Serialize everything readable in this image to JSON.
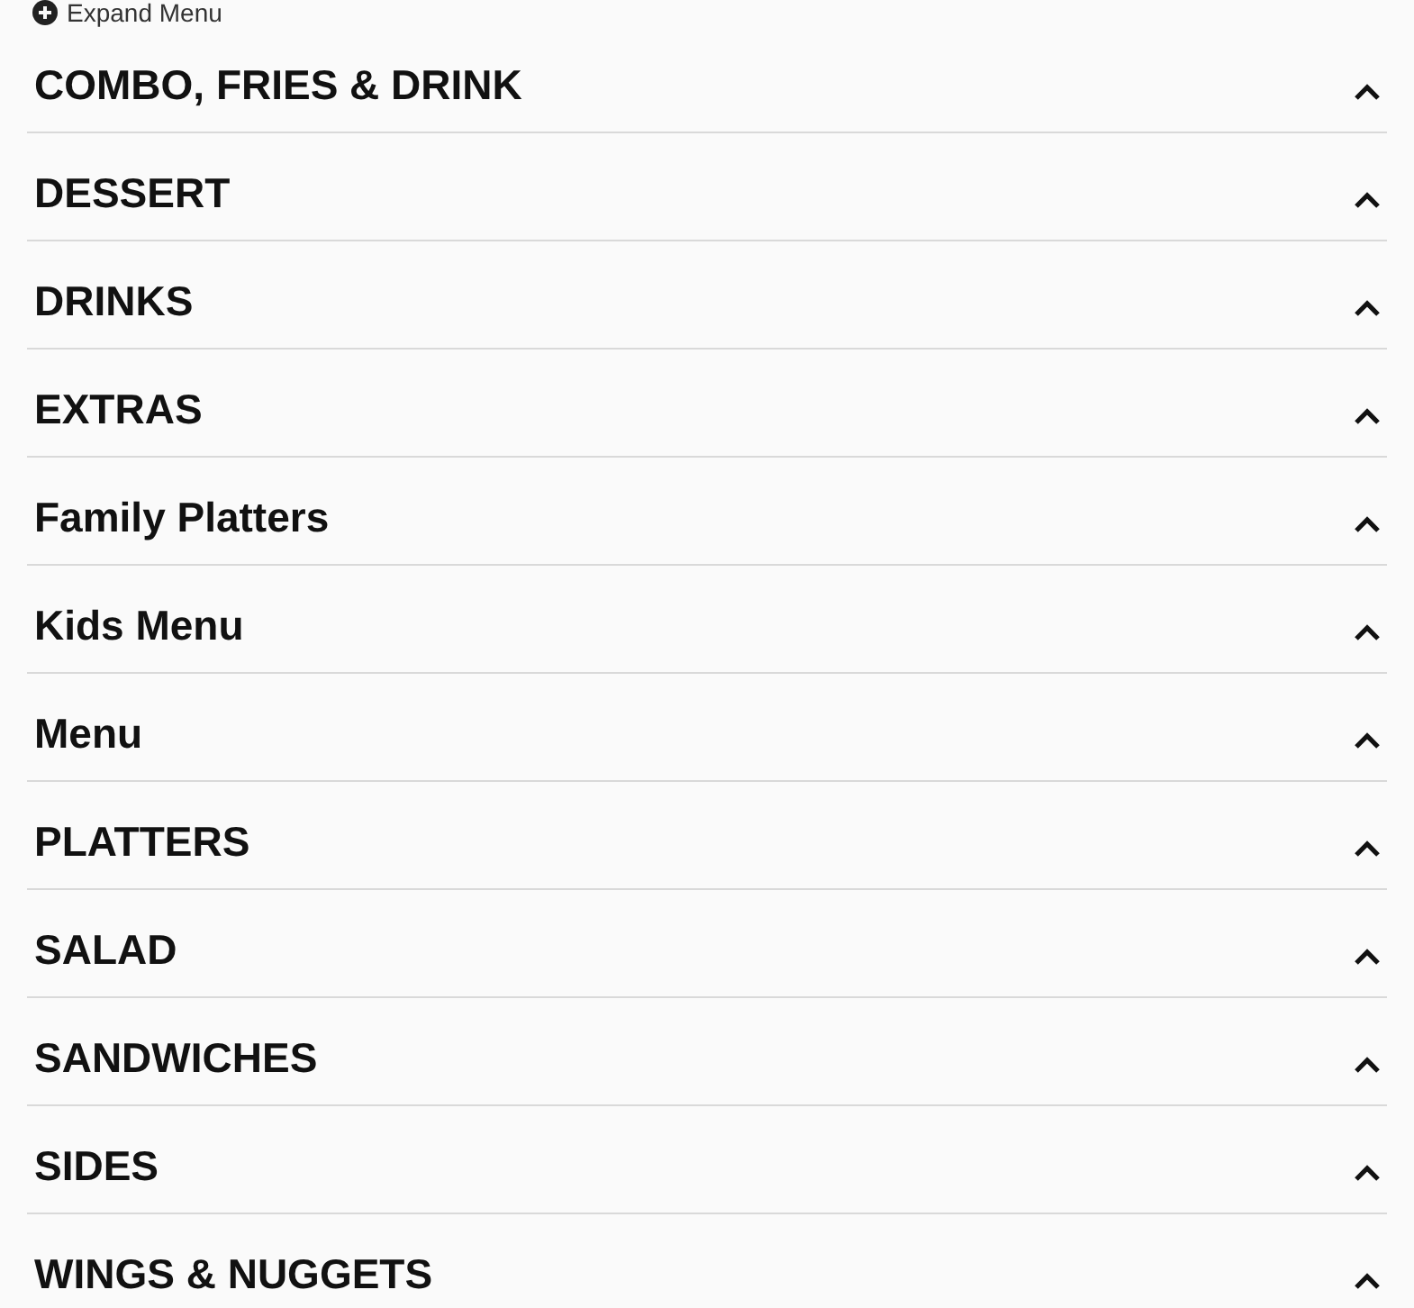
{
  "expand_menu": {
    "label": "Expand Menu"
  },
  "categories": [
    {
      "name": "COMBO, FRIES & DRINK"
    },
    {
      "name": "DESSERT"
    },
    {
      "name": "DRINKS"
    },
    {
      "name": "EXTRAS"
    },
    {
      "name": "Family Platters"
    },
    {
      "name": "Kids Menu"
    },
    {
      "name": "Menu"
    },
    {
      "name": "PLATTERS"
    },
    {
      "name": "SALAD"
    },
    {
      "name": "SANDWICHES"
    },
    {
      "name": "SIDES"
    },
    {
      "name": "WINGS & NUGGETS"
    }
  ]
}
